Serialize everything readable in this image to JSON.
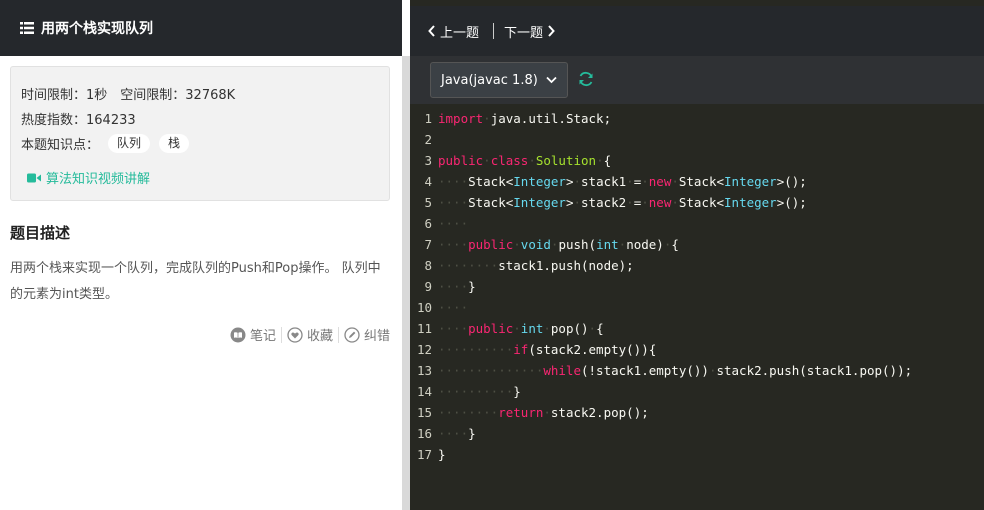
{
  "problem": {
    "title": "用两个栈实现队列",
    "time_limit": "时间限制：1秒",
    "space_limit": "空间限制：32768K",
    "heat": "热度指数：164233",
    "knowledge_label": "本题知识点：",
    "tags": [
      "队列",
      "栈"
    ],
    "video_link": "算法知识视频讲解",
    "desc_title": "题目描述",
    "desc_text": "用两个栈来实现一个队列，完成队列的Push和Pop操作。 队列中的元素为int类型。"
  },
  "actions": {
    "note": "笔记",
    "favorite": "收藏",
    "report": "纠错"
  },
  "nav": {
    "prev": "上一题",
    "next": "下一题"
  },
  "editor": {
    "language": "Java(javac 1.8)",
    "line_numbers": [
      "1",
      "2",
      "3",
      "4",
      "5",
      "6",
      "7",
      "8",
      "9",
      "10",
      "11",
      "12",
      "13",
      "14",
      "15",
      "16",
      "17"
    ]
  },
  "colors": {
    "accent": "#25bb9b",
    "header_bg": "#25282c",
    "editor_bg": "#272822",
    "keyword": "#f92672",
    "type": "#66d9ef",
    "class_name": "#a6e22e"
  }
}
